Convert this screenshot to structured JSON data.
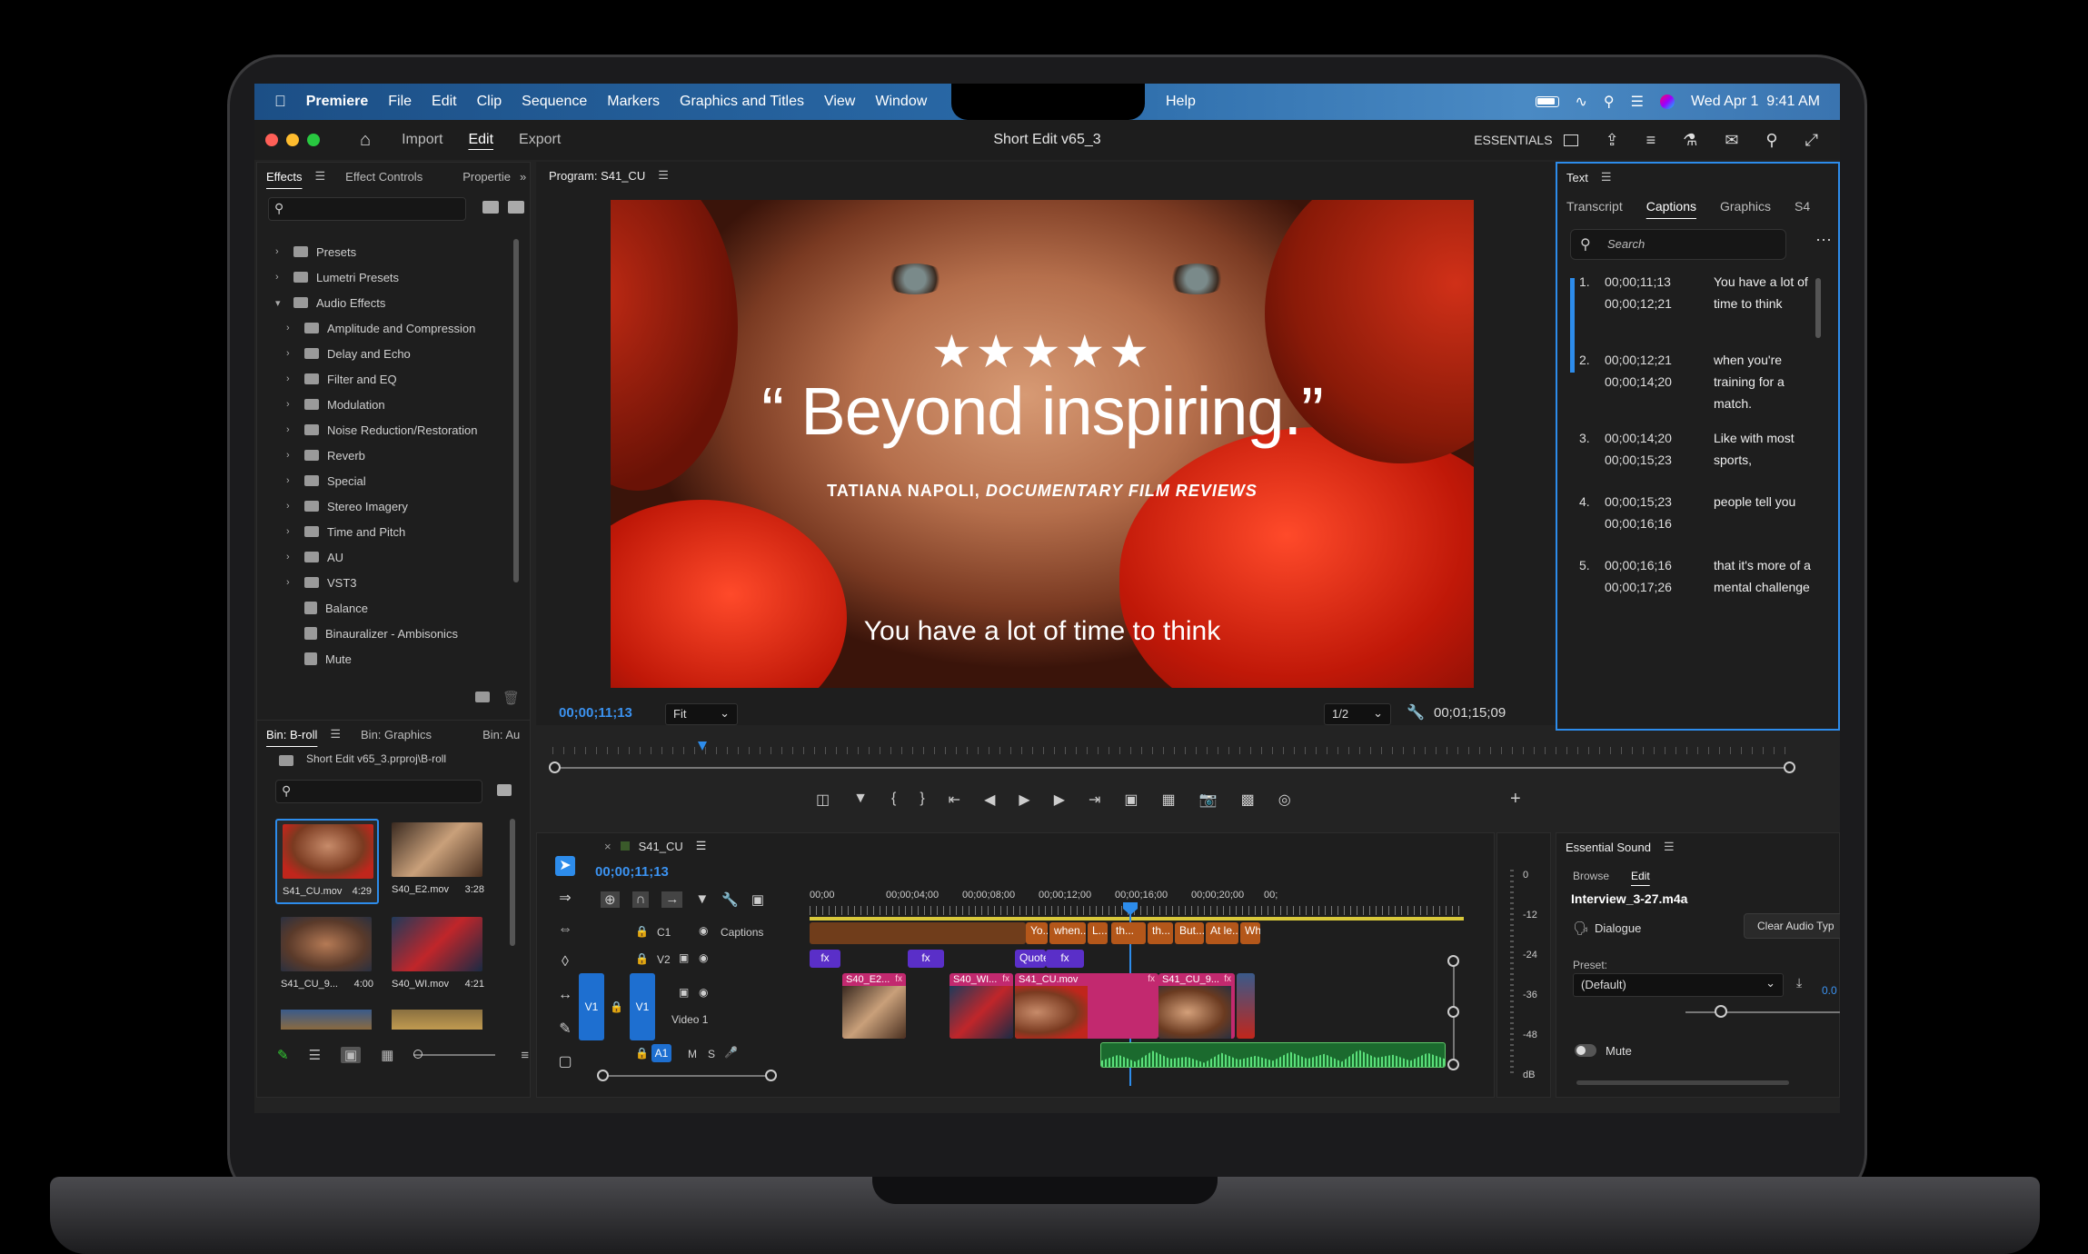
{
  "menubar": {
    "app": "Premiere",
    "items": [
      "File",
      "Edit",
      "Clip",
      "Sequence",
      "Markers",
      "Graphics and Titles",
      "View",
      "Window"
    ],
    "help": "Help",
    "datetime": "Wed Apr 1  9:41 AM"
  },
  "titlebar": {
    "tabs": [
      "Import",
      "Edit",
      "Export"
    ],
    "active_tab": "Edit",
    "doc_title": "Short Edit v65_3",
    "workspace": "ESSENTIALS"
  },
  "effects_panel": {
    "tabs": [
      "Effects",
      "Effect Controls",
      "Propertie"
    ],
    "items": [
      {
        "label": "Presets",
        "type": "folder",
        "level": 0,
        "open": false
      },
      {
        "label": "Lumetri Presets",
        "type": "folder",
        "level": 0,
        "open": false
      },
      {
        "label": "Audio Effects",
        "type": "folder",
        "level": 0,
        "open": true
      },
      {
        "label": "Amplitude and Compression",
        "type": "folder",
        "level": 1,
        "open": false
      },
      {
        "label": "Delay and Echo",
        "type": "folder",
        "level": 1,
        "open": false
      },
      {
        "label": "Filter and EQ",
        "type": "folder",
        "level": 1,
        "open": false
      },
      {
        "label": "Modulation",
        "type": "folder",
        "level": 1,
        "open": false
      },
      {
        "label": "Noise Reduction/Restoration",
        "type": "folder",
        "level": 1,
        "open": false
      },
      {
        "label": "Reverb",
        "type": "folder",
        "level": 1,
        "open": false
      },
      {
        "label": "Special",
        "type": "folder",
        "level": 1,
        "open": false
      },
      {
        "label": "Stereo Imagery",
        "type": "folder",
        "level": 1,
        "open": false
      },
      {
        "label": "Time and Pitch",
        "type": "folder",
        "level": 1,
        "open": false
      },
      {
        "label": "AU",
        "type": "folder",
        "level": 1,
        "open": false
      },
      {
        "label": "VST3",
        "type": "folder",
        "level": 1,
        "open": false
      },
      {
        "label": "Balance",
        "type": "effect",
        "level": 1
      },
      {
        "label": "Binauralizer - Ambisonics",
        "type": "effect",
        "level": 1
      },
      {
        "label": "Mute",
        "type": "effect",
        "level": 1
      }
    ]
  },
  "bin_panel": {
    "tabs": [
      "Bin: B-roll",
      "Bin: Graphics",
      "Bin: Au"
    ],
    "path": "Short Edit v65_3.prproj\\B-roll",
    "clips": [
      {
        "name": "S41_CU.mov",
        "dur": "4:29"
      },
      {
        "name": "S40_E2.mov",
        "dur": "3:28"
      },
      {
        "name": "S41_CU_9...",
        "dur": "4:00"
      },
      {
        "name": "S40_WI.mov",
        "dur": "4:21"
      }
    ]
  },
  "program": {
    "label": "Program: S41_CU",
    "stars": "★★★★★",
    "quote": "“ Beyond inspiring.”",
    "credit_name": "TATIANA NAPOLI, ",
    "credit_pub": "DOCUMENTARY FILM REVIEWS",
    "caption": "You have a lot of time to think",
    "timecode": "00;00;11;13",
    "fit": "Fit",
    "resolution": "1/2",
    "duration": "00;01;15;09"
  },
  "text_panel": {
    "title": "Text",
    "tabs": [
      "Transcript",
      "Captions",
      "Graphics",
      "S4"
    ],
    "active_tab": "Captions",
    "search_placeholder": "Search",
    "captions": [
      {
        "n": "1.",
        "in": "00;00;11;13",
        "out": "00;00;12;21",
        "text": "You have a lot of time to think"
      },
      {
        "n": "2.",
        "in": "00;00;12;21",
        "out": "00;00;14;20",
        "text": "when you're training for a match."
      },
      {
        "n": "3.",
        "in": "00;00;14;20",
        "out": "00;00;15;23",
        "text": "Like with most sports,"
      },
      {
        "n": "4.",
        "in": "00;00;15;23",
        "out": "00;00;16;16",
        "text": "people tell you"
      },
      {
        "n": "5.",
        "in": "00;00;16;16",
        "out": "00;00;17;26",
        "text": "that it's more of a mental challenge"
      }
    ]
  },
  "timeline": {
    "sequence": "S41_CU",
    "timecode": "00;00;11;13",
    "ruler": [
      "00;00",
      "00;00;04;00",
      "00;00;08;00",
      "00;00;12;00",
      "00;00;16;00",
      "00;00;20;00",
      "00;"
    ],
    "tracks": {
      "c1": "C1",
      "captions": "Captions",
      "v2": "V2",
      "v1": "V1",
      "video1": "Video 1",
      "a1": "A1",
      "m": "M",
      "s": "S"
    },
    "caption_clips": [
      "Yo...",
      "when...",
      "L...",
      "th...",
      "th...",
      "But...",
      "At le...",
      "Wh"
    ],
    "v2_clips": [
      "fx",
      "fx",
      "Quote",
      "fx"
    ],
    "v1_clips": [
      "S40_E2...",
      "S40_WI...",
      "S41_CU.mov",
      "S41_CU_9..."
    ],
    "fx": "fx"
  },
  "meter": {
    "labels": [
      "0",
      "-12",
      "-24",
      "-36",
      "-48",
      "dB"
    ]
  },
  "essential_sound": {
    "title": "Essential Sound",
    "tabs": [
      "Browse",
      "Edit"
    ],
    "file": "Interview_3-27.m4a",
    "type": "Dialogue",
    "clear_btn": "Clear Audio Typ",
    "preset_label": "Preset:",
    "preset_value": "(Default)",
    "mute": "Mute",
    "value_peek": "0.0"
  },
  "colors": {
    "accent": "#2d8ceb",
    "caption_clip": "#b4571a",
    "v2_clip": "#5a2fc8",
    "v1_pink": "#c2296f",
    "audio_green": "#2aa84a"
  }
}
